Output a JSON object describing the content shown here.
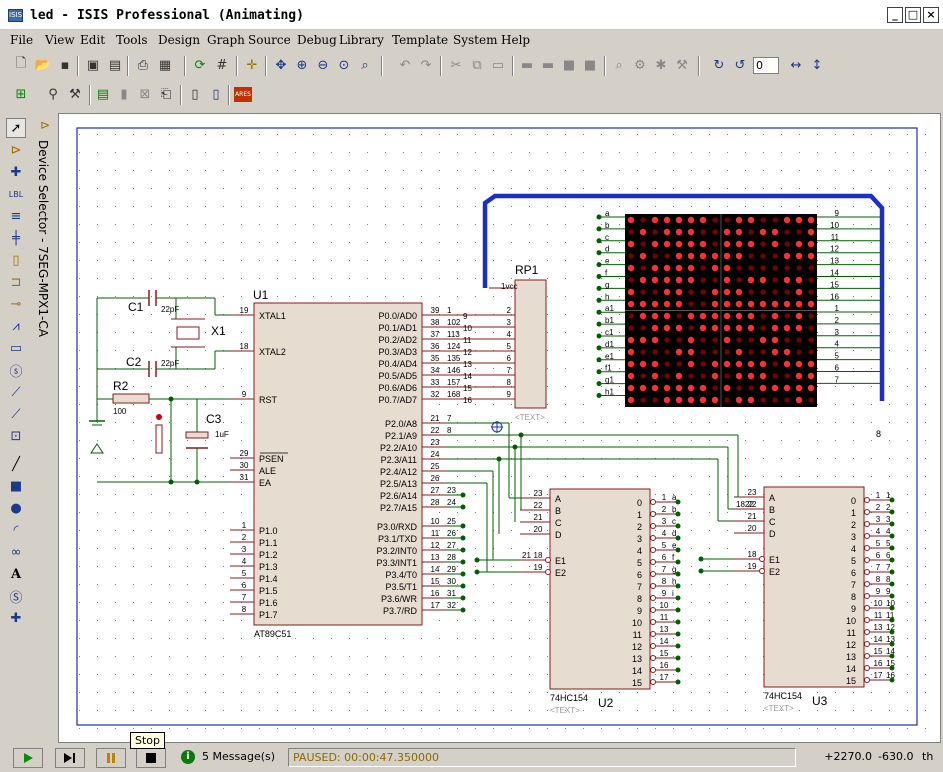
{
  "window": {
    "title": "led - ISIS Professional (Animating)",
    "icon_label": "ISIS"
  },
  "menu": [
    "File",
    "View",
    "Edit",
    "Tools",
    "Design",
    "Graph",
    "Source",
    "Debug",
    "Library",
    "Template",
    "System",
    "Help"
  ],
  "toolbar": {
    "zoom_value": "0"
  },
  "device_selector": {
    "label": "Device Selector - 7SEG-MPX1-CA"
  },
  "tooltip": "Stop",
  "status": {
    "messages": "5 Message(s)",
    "paused": "PAUSED: 00:00:47.350000",
    "coord_x": "+2270.0",
    "coord_y": "-630.0",
    "unit": "th"
  },
  "schematic": {
    "u1_ref": "U1",
    "u1_part": "AT89C51",
    "c1_ref": "C1",
    "c1_val": "22pF",
    "c2_ref": "C2",
    "c2_val": "22pF",
    "x1_ref": "X1",
    "r2_ref": "R2",
    "r2_val": "100",
    "c3_ref": "C3",
    "c3_val": "1uF",
    "rp1_ref": "RP1",
    "rp1_text": "<TEXT>",
    "rp1_pin1": "1vcc",
    "u2_ref": "U2",
    "u2_part": "74HC154",
    "u2_text": "<TEXT>",
    "u3_ref": "U3",
    "u3_part": "74HC154",
    "u3_text": "<TEXT>",
    "u1_left": [
      {
        "num": "19",
        "name": "XTAL1"
      },
      {
        "num": "18",
        "name": "XTAL2"
      },
      {
        "num": "9",
        "name": "RST"
      },
      {
        "num": "29",
        "name": "PSEN"
      },
      {
        "num": "30",
        "name": "ALE"
      },
      {
        "num": "31",
        "name": "EA"
      },
      {
        "num": "1",
        "name": "P1.0"
      },
      {
        "num": "2",
        "name": "P1.1"
      },
      {
        "num": "3",
        "name": "P1.2"
      },
      {
        "num": "4",
        "name": "P1.3"
      },
      {
        "num": "5",
        "name": "P1.4"
      },
      {
        "num": "6",
        "name": "P1.5"
      },
      {
        "num": "7",
        "name": "P1.6"
      },
      {
        "num": "8",
        "name": "P1.7"
      }
    ],
    "u1_right": [
      {
        "name": "P0.0/AD0",
        "pin": "39",
        "state": "1"
      },
      {
        "name": "P0.1/AD1",
        "pin": "38",
        "state": "102"
      },
      {
        "name": "P0.2/AD2",
        "pin": "37",
        "state": "113"
      },
      {
        "name": "P0.3/AD3",
        "pin": "36",
        "state": "124"
      },
      {
        "name": "P0.4/AD4",
        "pin": "35",
        "state": "135"
      },
      {
        "name": "P0.5/AD5",
        "pin": "34",
        "state": "146"
      },
      {
        "name": "P0.6/AD6",
        "pin": "33",
        "state": "157"
      },
      {
        "name": "P0.7/AD7",
        "pin": "32",
        "state": "168"
      },
      {
        "name": "P2.0/A8",
        "pin": "21",
        "state": "7"
      },
      {
        "name": "P2.1/A9",
        "pin": "22",
        "state": "8"
      },
      {
        "name": "P2.2/A10",
        "pin": "23",
        "state": ""
      },
      {
        "name": "P2.3/A11",
        "pin": "24",
        "state": ""
      },
      {
        "name": "P2.4/A12",
        "pin": "25",
        "state": ""
      },
      {
        "name": "P2.5/A13",
        "pin": "26",
        "state": ""
      },
      {
        "name": "P2.6/A14",
        "pin": "27",
        "state": "23"
      },
      {
        "name": "P2.7/A15",
        "pin": "28",
        "state": "24"
      },
      {
        "name": "P3.0/RXD",
        "pin": "10",
        "state": "25"
      },
      {
        "name": "P3.1/TXD",
        "pin": "11",
        "state": "26"
      },
      {
        "name": "P3.2/INT0",
        "pin": "12",
        "state": "27"
      },
      {
        "name": "P3.3/INT1",
        "pin": "13",
        "state": "28"
      },
      {
        "name": "P3.4/T0",
        "pin": "14",
        "state": "29"
      },
      {
        "name": "P3.5/T1",
        "pin": "15",
        "state": "30"
      },
      {
        "name": "P3.6/WR",
        "pin": "16",
        "state": "31"
      },
      {
        "name": "P3.7/RD",
        "pin": "17",
        "state": "32"
      }
    ],
    "rp1_pins": [
      {
        "pin": "2",
        "label": "9"
      },
      {
        "pin": "3",
        "label": "10"
      },
      {
        "pin": "4",
        "label": "11"
      },
      {
        "pin": "5",
        "label": "12"
      },
      {
        "pin": "6",
        "label": "13"
      },
      {
        "pin": "7",
        "label": "14"
      },
      {
        "pin": "8",
        "label": "15"
      },
      {
        "pin": "9",
        "label": "16"
      }
    ],
    "dec_inputs": [
      {
        "name": "A",
        "pin": "23"
      },
      {
        "name": "B",
        "pin": "22"
      },
      {
        "name": "C",
        "pin": "21"
      },
      {
        "name": "D",
        "pin": "20"
      },
      {
        "name": "E1",
        "pin": "18"
      },
      {
        "name": "E2",
        "pin": "19"
      }
    ],
    "u2_in_labels": [
      "",
      "",
      "",
      "",
      "21",
      ""
    ],
    "u3_in_labels": [
      "",
      "1822",
      "",
      "",
      "",
      ""
    ],
    "dec_out_pins": [
      "1",
      "2",
      "3",
      "4",
      "5",
      "6",
      "7",
      "8",
      "9",
      "10",
      "11",
      "13",
      "14",
      "15",
      "16",
      "17"
    ],
    "u2_out_labels": [
      "a",
      "b",
      "c",
      "d",
      "e",
      "f",
      "g",
      "h",
      "i",
      "",
      "",
      "",
      "",
      "",
      "",
      ""
    ],
    "u3_out_labels": [
      "1",
      "2",
      "3",
      "4",
      "5",
      "6",
      "7",
      "8",
      "9",
      "10",
      "11",
      "12",
      "13",
      "14",
      "15",
      "16"
    ],
    "matrix_left": [
      "a",
      "b",
      "c",
      "d",
      "e",
      "f",
      "g",
      "h",
      "a1",
      "b1",
      "c1",
      "d1",
      "e1",
      "f1",
      "g1",
      "h1"
    ],
    "matrix_right": [
      "9",
      "10",
      "11",
      "12",
      "13",
      "14",
      "15",
      "16",
      "1",
      "2",
      "3",
      "4",
      "5",
      "6",
      "7"
    ],
    "matrix_mark": "8",
    "matrix_lit_fraction": 0.55
  },
  "colors": {
    "chip_fill": "#e6dcd0",
    "chip_stroke": "#8b1a1a",
    "wire": "#006000",
    "bus": "#1a2fc8",
    "border": "#2030a0",
    "led_on": "#ff3030",
    "led_off": "#7a0000",
    "matrix_bg": "#000000"
  }
}
